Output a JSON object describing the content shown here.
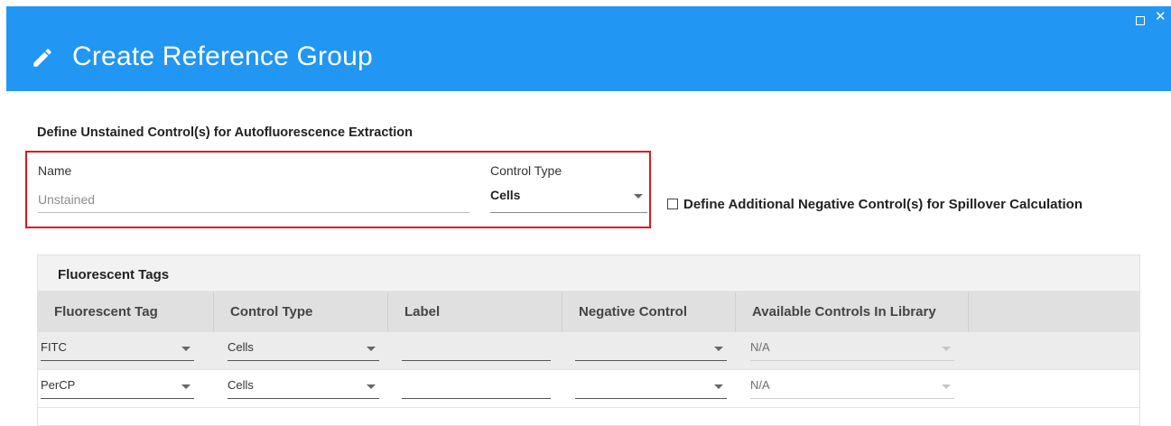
{
  "dialog": {
    "title": "Create Reference Group",
    "window_controls": {
      "maximize": "□",
      "close": "✕"
    },
    "header_icon": "pencil-icon",
    "accent_color": "#2196f3"
  },
  "unstained": {
    "section_title": "Define Unstained Control(s) for Autofluorescence Extraction",
    "name_label": "Name",
    "name_placeholder": "Unstained",
    "name_value": "",
    "control_type_label": "Control Type",
    "control_type_value": "Cells",
    "highlight_color": "#e0161c"
  },
  "negative_controls_checkbox": {
    "label": "Define Additional Negative Control(s) for Spillover Calculation",
    "checked": false
  },
  "fluorescent_tags": {
    "caption": "Fluorescent Tags",
    "columns": [
      "Fluorescent Tag",
      "Control Type",
      "Label",
      "Negative Control",
      "Available Controls In Library"
    ],
    "rows": [
      {
        "tag": "FITC",
        "control_type": "Cells",
        "label": "",
        "negative_control": "",
        "available": "N/A"
      },
      {
        "tag": "PerCP",
        "control_type": "Cells",
        "label": "",
        "negative_control": "",
        "available": "N/A"
      }
    ]
  }
}
